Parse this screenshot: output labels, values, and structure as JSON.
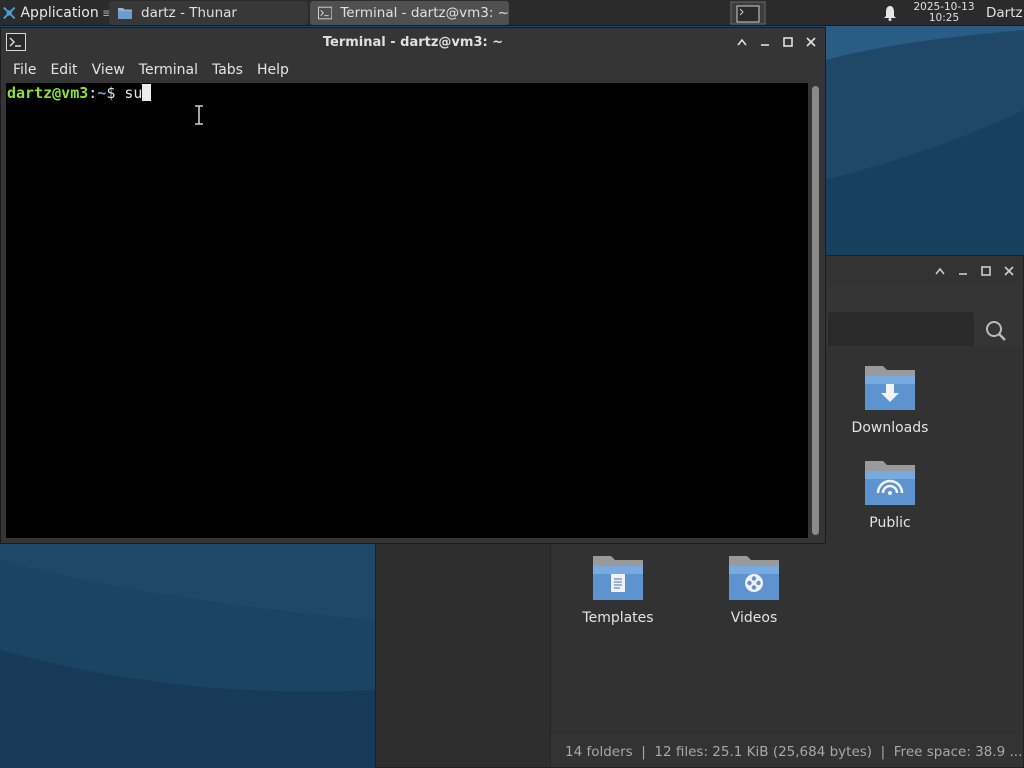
{
  "panel": {
    "applications_label": "Applications",
    "tasks": [
      {
        "label": "dartz - Thunar",
        "icon": "folder-icon"
      },
      {
        "label": "Terminal - dartz@vm3: ~",
        "icon": "terminal-icon"
      }
    ],
    "clock_date": "2025-10-13",
    "clock_time": "10:25",
    "user_label": "Dartz"
  },
  "terminal": {
    "title": "Terminal - dartz@vm3: ~",
    "menu": [
      "File",
      "Edit",
      "View",
      "Terminal",
      "Tabs",
      "Help"
    ],
    "prompt_user": "dartz@vm3",
    "prompt_colon": ":",
    "prompt_path": "~",
    "prompt_symbol": "$",
    "command": "su"
  },
  "thunar": {
    "folders": [
      {
        "label": "Downloads",
        "icon": "downloads-folder-icon"
      },
      {
        "label": "Public",
        "icon": "public-folder-icon"
      },
      {
        "label": "Templates",
        "icon": "templates-folder-icon"
      },
      {
        "label": "Videos",
        "icon": "videos-folder-icon"
      }
    ],
    "status_text": "14 folders  |  12 files: 25.1 KiB (25,684 bytes)  |  Free space: 38.9 ..."
  },
  "colors": {
    "desktop_background": "#1f4868",
    "prompt_user": "#8ae234",
    "prompt_path": "#6f9ed8",
    "terminal_background": "#000000"
  }
}
